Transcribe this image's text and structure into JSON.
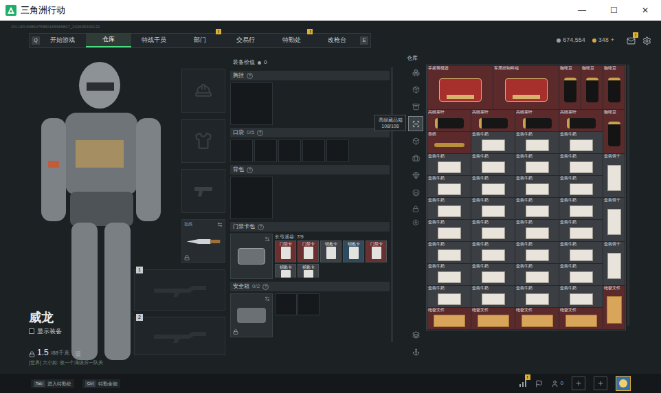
{
  "window": {
    "title": "三角洲行动",
    "controls": [
      "—",
      "☐",
      "✕"
    ]
  },
  "header": {
    "uid": "CN UID:9086475850165965847_202605300133",
    "prev_key": "Q",
    "next_key": "E"
  },
  "tabs": [
    {
      "label": "开始游戏",
      "selected": false,
      "badge": ""
    },
    {
      "label": "仓库",
      "selected": true,
      "badge": ""
    },
    {
      "label": "特战干员",
      "selected": false,
      "badge": ""
    },
    {
      "label": "部门",
      "selected": false,
      "badge": "!"
    },
    {
      "label": "交易行",
      "selected": false,
      "badge": ""
    },
    {
      "label": "特勤处",
      "selected": false,
      "badge": "!"
    },
    {
      "label": "改枪台",
      "selected": false,
      "badge": ""
    }
  ],
  "currencies": [
    {
      "value": "674,554",
      "action": ""
    },
    {
      "value": "348",
      "action": "+"
    }
  ],
  "mail": {
    "badge": "!"
  },
  "character": {
    "name": "威龙",
    "show_equipment": {
      "label": "显示装备",
      "checked": false
    },
    "weight": "1.5",
    "weight_max": "/88千克",
    "chat": "[世界] 大小姐: 收一个满级后一队关"
  },
  "equipment_slots": [
    {
      "kind": "helmet",
      "label": "",
      "locked": false,
      "swap": false
    },
    {
      "kind": "armor",
      "label": "",
      "locked": false,
      "swap": false
    },
    {
      "kind": "pistol",
      "label": "",
      "locked": false,
      "swap": false
    },
    {
      "kind": "melee",
      "label": "近战",
      "locked": true,
      "swap": true
    }
  ],
  "weapon_slots": [
    {
      "number": "1"
    },
    {
      "number": "2"
    }
  ],
  "loadout": {
    "value_label": "装备价值",
    "value": "0",
    "help": "?",
    "chest": {
      "title": "胸挂"
    },
    "pocket": {
      "title": "口袋",
      "count": "0/5",
      "slots": 5
    },
    "backpack": {
      "title": "背包"
    },
    "keycard": {
      "title": "门禁卡包",
      "map": "长弓溪谷: 7/9",
      "cards": [
        {
          "name": "门禁卡",
          "color": "#6b2f2f"
        },
        {
          "name": "门禁卡",
          "color": "#6b2f2f"
        },
        {
          "name": "钥匙卡",
          "color": "#3d4145"
        },
        {
          "name": "钥匙卡",
          "color": "#2f4a5c"
        },
        {
          "name": "门禁卡",
          "color": "#6b2f2f"
        },
        {
          "name": "钥匙卡",
          "color": "#3d4145"
        },
        {
          "name": "钥匙卡",
          "color": "#3d4145"
        }
      ]
    },
    "safe": {
      "title": "安全箱",
      "count": "0/2",
      "slots": 2,
      "locked": true
    }
  },
  "tooltip": {
    "title": "高级藏品箱",
    "count": "108/108"
  },
  "warehouse": {
    "title": "仓库",
    "tabs": [
      {
        "selected": false
      },
      {
        "selected": false
      },
      {
        "selected": false
      },
      {
        "selected": true
      },
      {
        "selected": false
      },
      {
        "selected": false
      },
      {
        "selected": false
      },
      {
        "selected": false
      }
    ],
    "items": [
      {
        "name": "手摇警报器",
        "kind": "device",
        "color": "#5c2a2a"
      },
      {
        "name": "军用控制终端",
        "kind": "device",
        "color": "#5c2a2a"
      },
      {
        "name": "咖啡豆",
        "kind": "bag",
        "color": "#5c2a2a"
      },
      {
        "name": "咖啡豆",
        "kind": "bag",
        "color": "#5c2a2a"
      },
      {
        "name": "咖啡豆",
        "kind": "bag",
        "color": "#5c2a2a"
      },
      {
        "name": "高级茶叶",
        "kind": "case",
        "color": "#5c2a2a"
      },
      {
        "name": "高级茶叶",
        "kind": "case",
        "color": "#5c2a2a"
      },
      {
        "name": "高级茶叶",
        "kind": "case",
        "color": "#5c2a2a"
      },
      {
        "name": "高级茶叶",
        "kind": "case",
        "color": "#5c2a2a"
      },
      {
        "name": "咖啡豆",
        "kind": "bag",
        "color": "#5c2a2a"
      },
      {
        "name": "香槟",
        "kind": "bottle",
        "color": "#5c2a2a"
      },
      {
        "name": "盒装牛奶",
        "kind": "box",
        "color": "#3b3e42"
      },
      {
        "name": "盒装牛奶",
        "kind": "box",
        "color": "#3b3e42"
      },
      {
        "name": "盒装牛奶",
        "kind": "box",
        "color": "#3b3e42"
      },
      {
        "name": "盒装牛奶",
        "kind": "box",
        "color": "#3b3e42"
      },
      {
        "name": "盒装牛奶",
        "kind": "box",
        "color": "#3b3e42"
      },
      {
        "name": "盒装牛奶",
        "kind": "box",
        "color": "#3b3e42"
      },
      {
        "name": "盒装牛奶",
        "kind": "box",
        "color": "#3b3e42"
      },
      {
        "name": "盒装饼干",
        "kind": "carton",
        "color": "#3b3e42"
      },
      {
        "name": "盒装牛奶",
        "kind": "box",
        "color": "#3b3e42"
      },
      {
        "name": "盒装牛奶",
        "kind": "box",
        "color": "#3b3e42"
      },
      {
        "name": "盒装牛奶",
        "kind": "box",
        "color": "#3b3e42"
      },
      {
        "name": "盒装牛奶",
        "kind": "box",
        "color": "#3b3e42"
      },
      {
        "name": "盒装牛奶",
        "kind": "box",
        "color": "#3b3e42"
      },
      {
        "name": "盒装牛奶",
        "kind": "box",
        "color": "#3b3e42"
      },
      {
        "name": "盒装牛奶",
        "kind": "box",
        "color": "#3b3e42"
      },
      {
        "name": "盒装牛奶",
        "kind": "box",
        "color": "#3b3e42"
      },
      {
        "name": "盒装饼干",
        "kind": "carton",
        "color": "#3b3e42"
      },
      {
        "name": "盒装牛奶",
        "kind": "box",
        "color": "#3b3e42"
      },
      {
        "name": "盒装牛奶",
        "kind": "box",
        "color": "#3b3e42"
      },
      {
        "name": "盒装牛奶",
        "kind": "box",
        "color": "#3b3e42"
      },
      {
        "name": "盒装牛奶",
        "kind": "box",
        "color": "#3b3e42"
      },
      {
        "name": "盒装牛奶",
        "kind": "box",
        "color": "#3b3e42"
      },
      {
        "name": "盒装牛奶",
        "kind": "box",
        "color": "#3b3e42"
      },
      {
        "name": "盒装牛奶",
        "kind": "box",
        "color": "#3b3e42"
      },
      {
        "name": "盒装牛奶",
        "kind": "box",
        "color": "#3b3e42"
      },
      {
        "name": "盒装饼干",
        "kind": "carton",
        "color": "#3b3e42"
      },
      {
        "name": "盒装牛奶",
        "kind": "box",
        "color": "#3b3e42"
      },
      {
        "name": "盒装牛奶",
        "kind": "box",
        "color": "#3b3e42"
      },
      {
        "name": "盒装牛奶",
        "kind": "box",
        "color": "#3b3e42"
      },
      {
        "name": "盒装牛奶",
        "kind": "box",
        "color": "#3b3e42"
      },
      {
        "name": "盒装牛奶",
        "kind": "box",
        "color": "#3b3e42"
      },
      {
        "name": "盒装牛奶",
        "kind": "box",
        "color": "#3b3e42"
      },
      {
        "name": "盒装牛奶",
        "kind": "box",
        "color": "#3b3e42"
      },
      {
        "name": "盒装牛奶",
        "kind": "box",
        "color": "#3b3e42"
      },
      {
        "name": "绝密文件",
        "kind": "folder",
        "color": "#5c2a2a"
      },
      {
        "name": "绝密文件",
        "kind": "paper",
        "color": "#5c2a2a"
      },
      {
        "name": "绝密文件",
        "kind": "paper",
        "color": "#5c2a2a"
      },
      {
        "name": "绝密文件",
        "kind": "paper",
        "color": "#5c2a2a"
      },
      {
        "name": "绝密文件",
        "kind": "paper",
        "color": "#5c2a2a"
      }
    ]
  },
  "bottom_bar": {
    "hints": [
      {
        "key": "Tab",
        "label": "进入特勤处"
      },
      {
        "key": "Ctrl",
        "label": "特勤全能"
      }
    ],
    "stats_badge": "!",
    "friends": "0"
  }
}
